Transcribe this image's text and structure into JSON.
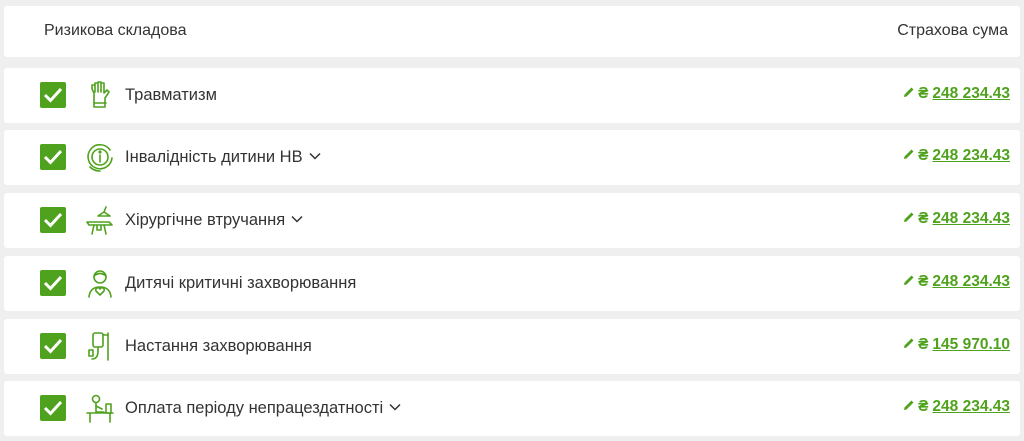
{
  "header": {
    "left": "Ризикова складова",
    "right": "Страхова сума"
  },
  "colors": {
    "accent": "#4fa21d",
    "text": "#333333",
    "background": "#efefef"
  },
  "currency": "₴",
  "rows": [
    {
      "label": "Травматизм",
      "icon": "glove-icon",
      "expandable": false,
      "checked": true,
      "amount": "248 234.43"
    },
    {
      "label": "Інвалідність дитини НВ",
      "icon": "disability-info-icon",
      "expandable": true,
      "checked": true,
      "amount": "248 234.43"
    },
    {
      "label": "Хірургічне втручання",
      "icon": "surgery-lamp-icon",
      "expandable": true,
      "checked": true,
      "amount": "248 234.43"
    },
    {
      "label": "Дитячі критичні захворювання",
      "icon": "child-heart-icon",
      "expandable": false,
      "checked": true,
      "amount": "248 234.43"
    },
    {
      "label": "Настання захворювання",
      "icon": "iv-drip-icon",
      "expandable": false,
      "checked": true,
      "amount": "145 970.10"
    },
    {
      "label": "Оплата періоду непрацездатності",
      "icon": "sick-leave-icon",
      "expandable": true,
      "checked": true,
      "amount": "248 234.43"
    }
  ]
}
